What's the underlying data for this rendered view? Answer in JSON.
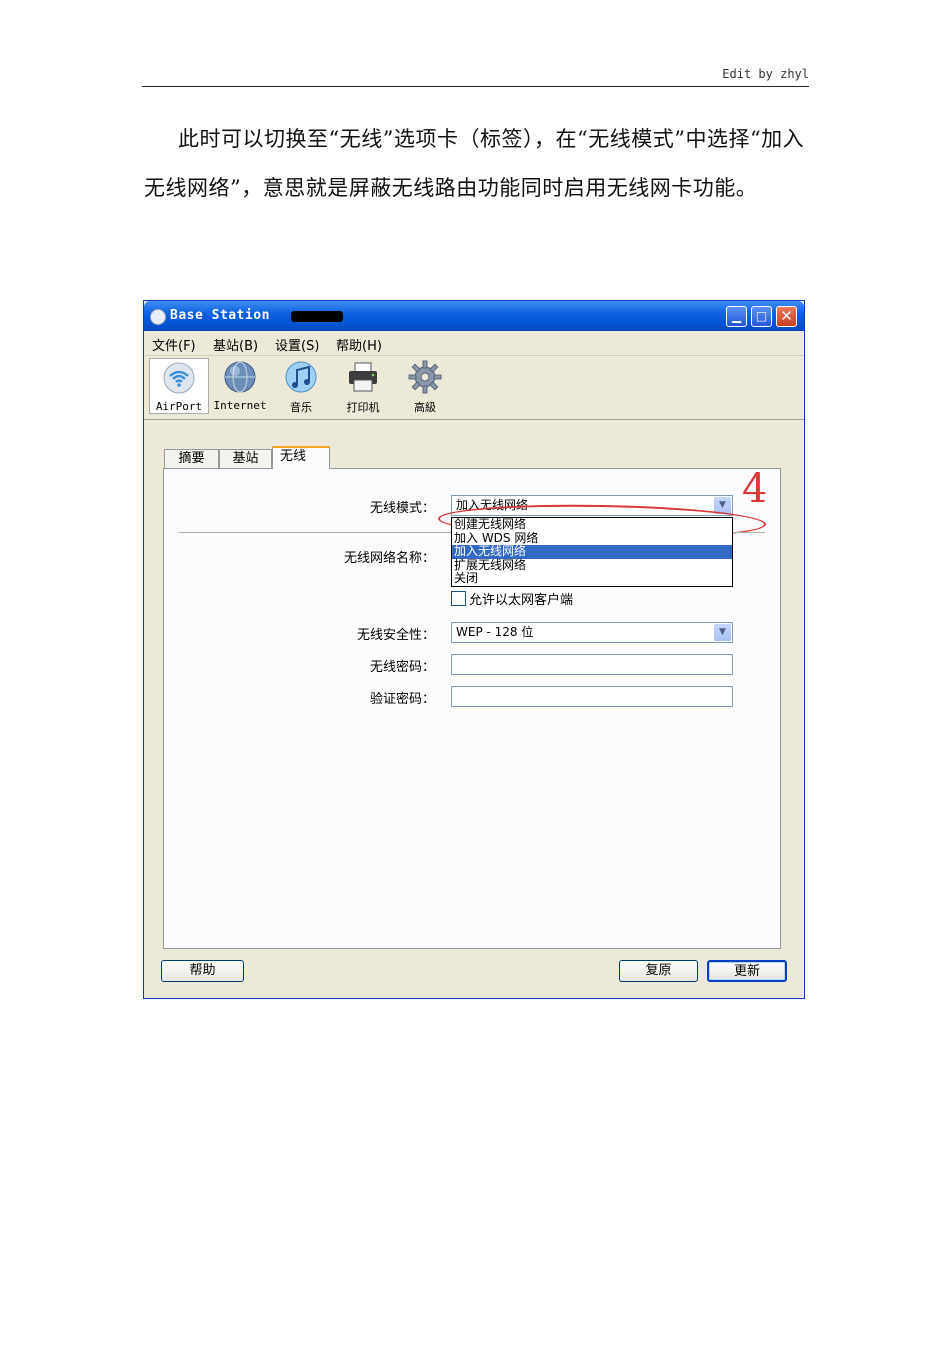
{
  "header": {
    "text": "Edit by zhyl"
  },
  "paragraph": "此时可以切换至“无线”选项卡（标签），在“无线模式”中选择“加入无线网络”，意思就是屏蔽无线路由功能同时启用无线网卡功能。",
  "window": {
    "title": "Base Station",
    "menu": [
      "文件(F)",
      "基站(B)",
      "设置(S)",
      "帮助(H)"
    ],
    "toolbar": [
      {
        "label": "AirPort",
        "icon": "airport-icon",
        "active": true
      },
      {
        "label": "Internet",
        "icon": "globe-icon",
        "active": false
      },
      {
        "label": "音乐",
        "icon": "music-icon",
        "active": false
      },
      {
        "label": "打印机",
        "icon": "printer-icon",
        "active": false
      },
      {
        "label": "高級",
        "icon": "gear-icon",
        "active": false
      }
    ],
    "tabs": [
      {
        "label": "摘要",
        "active": false
      },
      {
        "label": "基站",
        "active": false
      },
      {
        "label": "无线",
        "active": true
      }
    ],
    "annotation_number": "4",
    "form": {
      "wireless_mode_label": "无线模式：",
      "wireless_mode_value": "加入无线网络",
      "mode_options": [
        "创建无线网络",
        "加入 WDS 网络",
        "加入无线网络",
        "扩展无线网络",
        "关闭"
      ],
      "mode_selected_index": 2,
      "network_name_label": "无线网络名称：",
      "allow_ethernet_label": "允许以太网客户端",
      "allow_ethernet_checked": false,
      "security_label": "无线安全性：",
      "security_value": "WEP - 128 位",
      "password_label": "无线密码：",
      "verify_label": "验证密码："
    },
    "buttons": {
      "help": "帮助",
      "revert": "复原",
      "update": "更新"
    }
  }
}
